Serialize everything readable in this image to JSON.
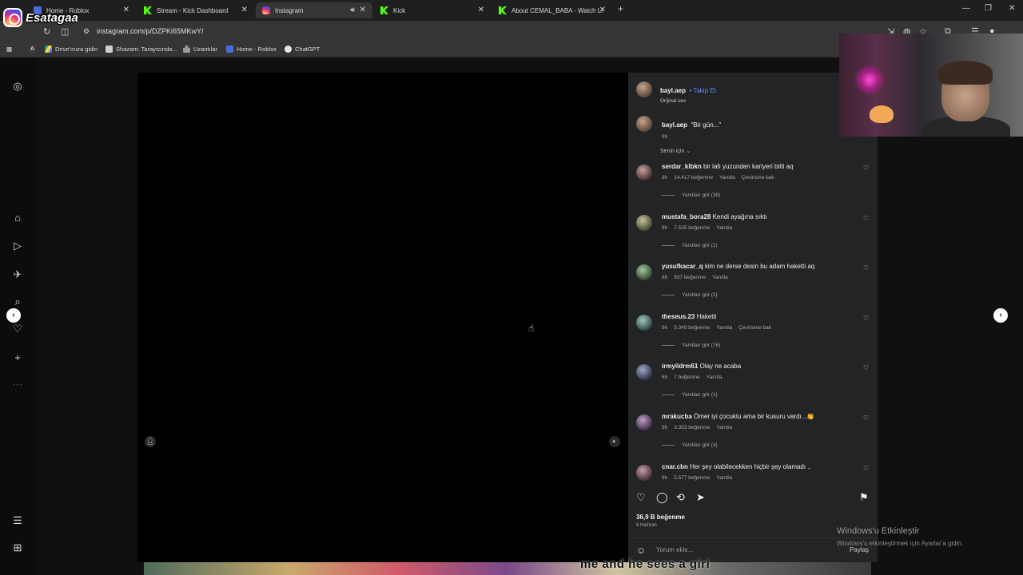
{
  "browser": {
    "tabs": [
      {
        "label": "Home - Roblox",
        "icon": "roblox-icon"
      },
      {
        "label": "Stream - Kick Dashboard",
        "icon": "kick-icon"
      },
      {
        "label": "Instagram",
        "icon": "instagram-icon",
        "active": true
      },
      {
        "label": "Kick",
        "icon": "kick-icon"
      },
      {
        "label": "About CEMAL_BABA - Watch Li",
        "icon": "kick-icon"
      }
    ],
    "new_tab": "+",
    "url": "instagram.com/p/DZPKi65MKwY/",
    "bookmarks": [
      "Drive'ınıza gidin",
      "Shazam: Tarayıcında...",
      "Uzantılar",
      "Home - Roblox",
      "ChatGPT"
    ]
  },
  "overlay": {
    "channel_name": "Esatagaa"
  },
  "post": {
    "author": "bayl.aep",
    "follow_label": "Takip Et",
    "audio": "Orijinal ses",
    "caption_user": "bayl.aep",
    "caption_text": "\"Bir gün...\"",
    "caption_time": "9h",
    "sort_label": "Senin için",
    "likes": "36,9 B beğenme",
    "date": "6 Haziran",
    "add_comment_placeholder": "Yorum ekle...",
    "post_label": "Paylaş"
  },
  "comments": [
    {
      "user": "serdar_klbkn",
      "text": "bir lafı yuzunden kariyeri bitti aq",
      "time": "9h",
      "likes": "14.417 beğenme",
      "reply": "Yanıtla",
      "translate": "Çevirisine bak",
      "replies": "Yanıtları gör (38)"
    },
    {
      "user": "mustafa_bora28",
      "text": "Kendi ayağına sıktı",
      "time": "9h",
      "likes": "7.535 beğenme",
      "reply": "Yanıtla",
      "translate": "",
      "replies": "Yanıtları gör (1)"
    },
    {
      "user": "yusufkacar_q",
      "text": "kim ne derse desin bu adam haketti aq",
      "time": "8h",
      "likes": "837 beğenme",
      "reply": "Yanıtla",
      "translate": "",
      "replies": "Yanıtları gör (2)"
    },
    {
      "user": "theseus.23",
      "text": "Haketti",
      "time": "9h",
      "likes": "5.349 beğenme",
      "reply": "Yanıtla",
      "translate": "Çevirisine bak",
      "replies": "Yanıtları gör (76)"
    },
    {
      "user": "irmyildrm61",
      "text": "Olay ne acaba",
      "time": "6h",
      "likes": "7 beğenme",
      "reply": "Yanıtla",
      "translate": "",
      "replies": "Yanıtları gör (1)"
    },
    {
      "user": "mrakucba",
      "text": "Ömer iyi çocuktu ama bir kusuru vardı...👏",
      "time": "9h",
      "likes": "3.353 beğenme",
      "reply": "Yanıtla",
      "translate": "",
      "replies": "Yanıtları gör (4)"
    },
    {
      "user": "cnar.cbn",
      "text": "Her şey olabilecekken hiçbir şey olamadı ..",
      "time": "9h",
      "likes": "5.577 beğenme",
      "reply": "Yanıtla",
      "translate": "",
      "replies": ""
    }
  ],
  "stream_caption": "me and he sees a girl",
  "watermark": {
    "title": "Windows'u Etkinleştir",
    "subtitle": "Windows'u etkinleştirmek için Ayarlar'a gidin."
  },
  "colors": {
    "accent": "#6a8cff",
    "panel": "#222426",
    "kick": "#53fc18"
  }
}
